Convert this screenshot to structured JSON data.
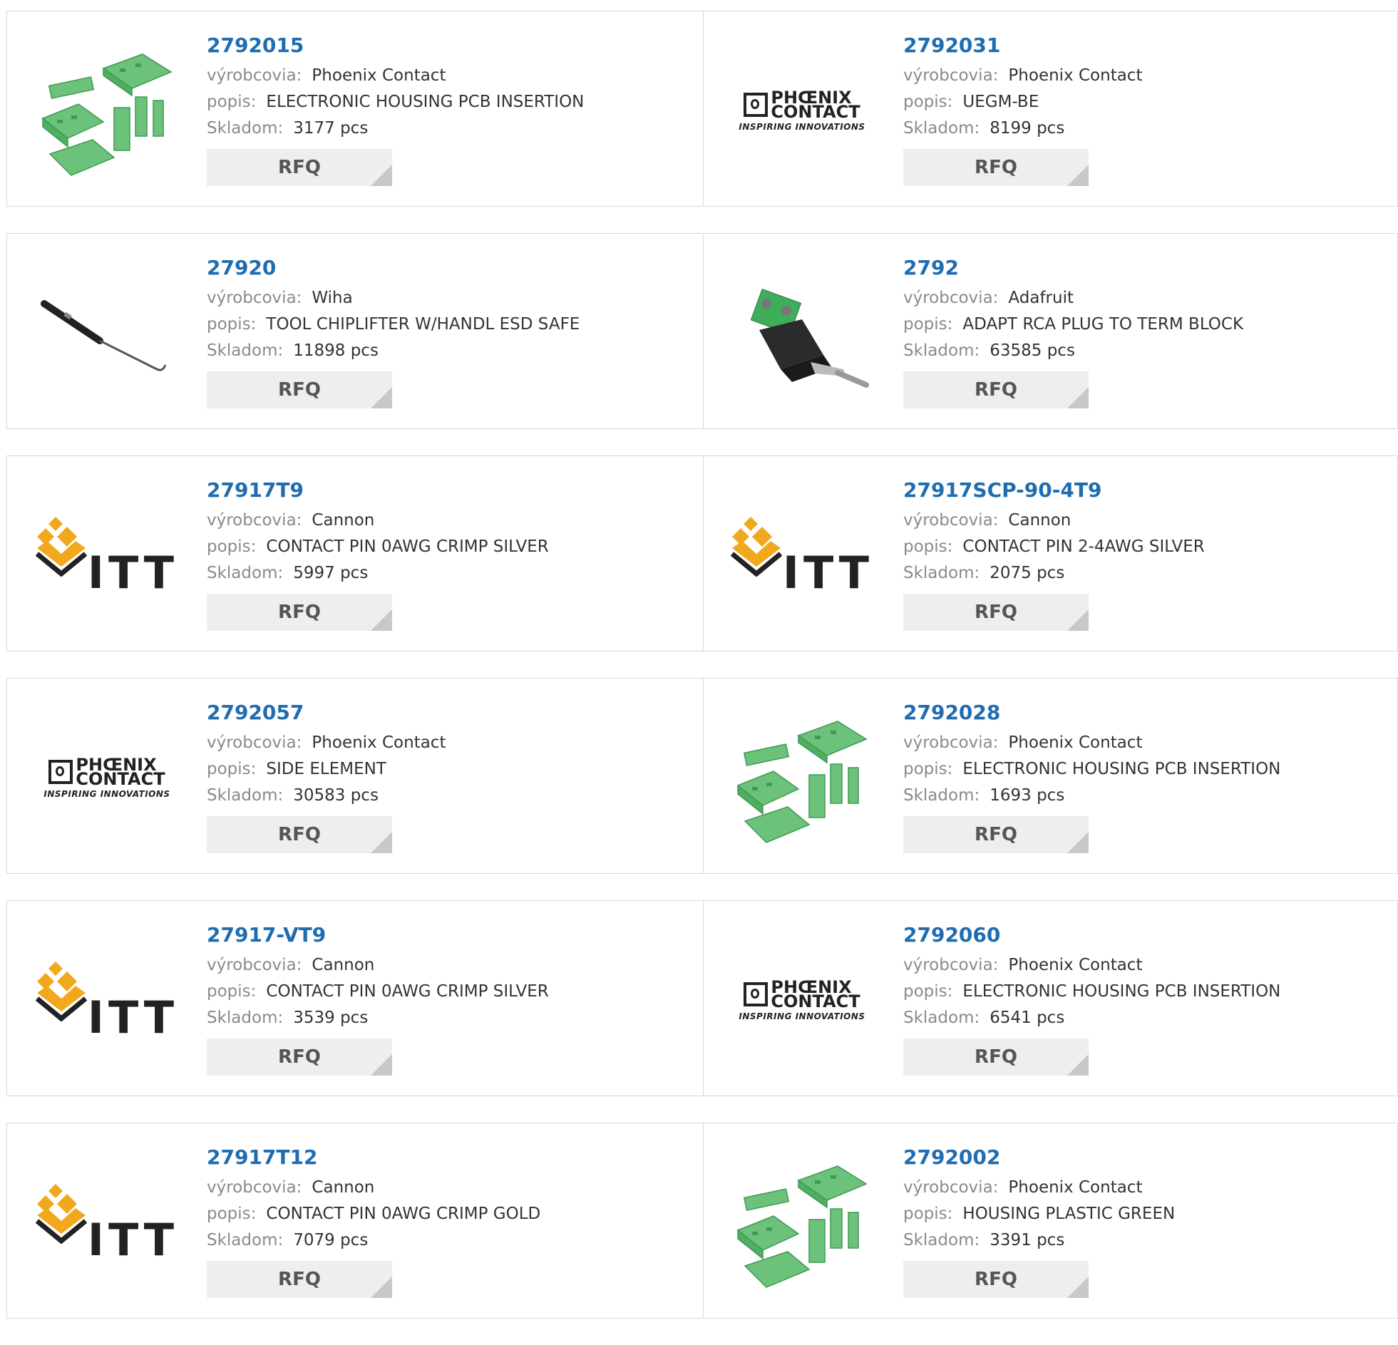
{
  "labels": {
    "manufacturer": "výrobcovia:",
    "description": "popis:",
    "stock": "Skladom:",
    "rfq": "RFQ"
  },
  "products": [
    {
      "pn": "2792015",
      "manufacturer": "Phoenix Contact",
      "description": "ELECTRONIC HOUSING PCB INSERTION",
      "stock": "3177 pcs",
      "image": "green-housing"
    },
    {
      "pn": "2792031",
      "manufacturer": "Phoenix Contact",
      "description": "UEGM-BE",
      "stock": "8199 pcs",
      "image": "phoenix-logo"
    },
    {
      "pn": "27920",
      "manufacturer": "Wiha",
      "description": "TOOL CHIPLIFTER W/HANDL ESD SAFE",
      "stock": "11898 pcs",
      "image": "chiplifter-tool"
    },
    {
      "pn": "2792",
      "manufacturer": "Adafruit",
      "description": "ADAPT RCA PLUG TO TERM BLOCK",
      "stock": "63585 pcs",
      "image": "rca-adapter"
    },
    {
      "pn": "27917T9",
      "manufacturer": "Cannon",
      "description": "CONTACT PIN 0AWG CRIMP SILVER",
      "stock": "5997 pcs",
      "image": "itt-logo"
    },
    {
      "pn": "27917SCP-90-4T9",
      "manufacturer": "Cannon",
      "description": "CONTACT PIN 2-4AWG SILVER",
      "stock": "2075 pcs",
      "image": "itt-logo"
    },
    {
      "pn": "2792057",
      "manufacturer": "Phoenix Contact",
      "description": "SIDE ELEMENT",
      "stock": "30583 pcs",
      "image": "phoenix-logo"
    },
    {
      "pn": "2792028",
      "manufacturer": "Phoenix Contact",
      "description": "ELECTRONIC HOUSING PCB INSERTION",
      "stock": "1693 pcs",
      "image": "green-housing"
    },
    {
      "pn": "27917-VT9",
      "manufacturer": "Cannon",
      "description": "CONTACT PIN 0AWG CRIMP SILVER",
      "stock": "3539 pcs",
      "image": "itt-logo"
    },
    {
      "pn": "2792060",
      "manufacturer": "Phoenix Contact",
      "description": "ELECTRONIC HOUSING PCB INSERTION",
      "stock": "6541 pcs",
      "image": "phoenix-logo"
    },
    {
      "pn": "27917T12",
      "manufacturer": "Cannon",
      "description": "CONTACT PIN 0AWG CRIMP GOLD",
      "stock": "7079 pcs",
      "image": "itt-logo"
    },
    {
      "pn": "2792002",
      "manufacturer": "Phoenix Contact",
      "description": "HOUSING PLASTIC GREEN",
      "stock": "3391 pcs",
      "image": "green-housing"
    }
  ],
  "logos": {
    "phoenix_line1": "PHŒNIX",
    "phoenix_line2": "CONTACT",
    "phoenix_tagline": "INSPIRING INNOVATIONS",
    "itt_text": "ITT"
  },
  "colors": {
    "part_number": "#1f6db0",
    "label": "#8a8a8a",
    "rfq_bg": "#eeeeee",
    "housing_green": "#6cc27a",
    "itt_orange": "#f2a81d"
  }
}
